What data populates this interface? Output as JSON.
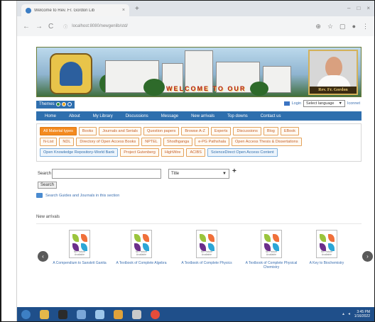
{
  "browser": {
    "tab_title": "Welcome to Rev. Fr. Gordon Lib",
    "tab_close": "×",
    "new_tab": "+",
    "url": "localhost:8080/newgenlib/std/",
    "nav": {
      "back": "←",
      "forward": "→",
      "reload": "C"
    },
    "window_controls": [
      "–",
      "□",
      "×"
    ]
  },
  "banner": {
    "welcome_text": "WELCOME TO OUR",
    "portrait_caption": "Rev. Fr. Gordon"
  },
  "toolbar": {
    "themes_label": "Themes",
    "theme_colors": [
      "#2f8f3a",
      "#e8a21d",
      "#2c6fbf"
    ],
    "login_label": "Login",
    "language_select": "Select language",
    "language_caret": "▼",
    "suffix": "Iconnet"
  },
  "menu": [
    "Home",
    "About",
    "My Library",
    "Discussions",
    "Message",
    "New arrivals",
    "Top downs",
    "Contact us"
  ],
  "filters": [
    [
      "All Material types",
      "Books",
      "Journals and Serials",
      "Question papers",
      "Browse A-Z",
      "Experts",
      "Discussions",
      "Blog",
      "EBook"
    ],
    [
      "N-List",
      "NDL",
      "Directory of Open Access Books",
      "NPTEL",
      "Shodhganga",
      "e-PG Pathshala",
      "Open Access Thesis & Dissertations"
    ],
    [
      "Open Knowledge Repository-World Bank",
      "Project Gutenberg",
      "HighWire",
      "ACIBS",
      "ScienceDirect Open Access Content"
    ]
  ],
  "search": {
    "label": "Search",
    "field_value": "",
    "option": "Title",
    "plus": "+",
    "button": "Search"
  },
  "guide_text": "Search Guides and Journals in this section",
  "new_arrivals": {
    "heading": "New arrivals",
    "prev": "‹",
    "next": "›",
    "no_picture": "No Picture Available",
    "books": [
      {
        "title": "A Compendium to Sanskrit Ganita"
      },
      {
        "title": "A Textbook of Complete Algebra"
      },
      {
        "title": "A Textbook of Complete Physics"
      },
      {
        "title": "A Textbook of Complete Physical Chemistry"
      },
      {
        "title": "A Key to Biochemistry"
      }
    ]
  },
  "taskbar": {
    "time": "3:45 PM",
    "date": "1/16/2022"
  }
}
